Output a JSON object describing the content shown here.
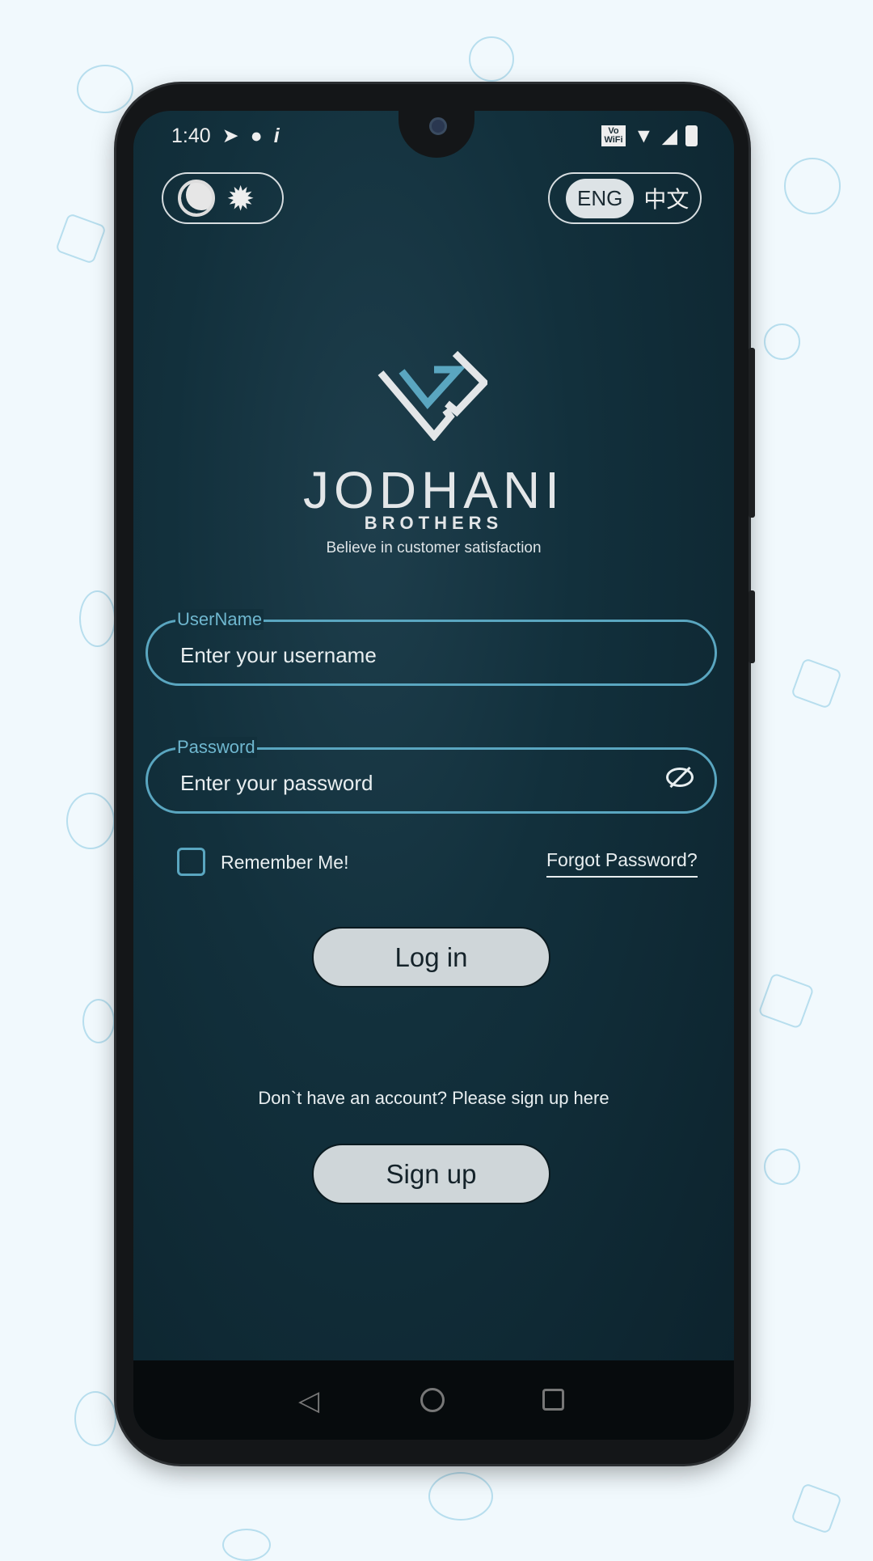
{
  "status_bar": {
    "time": "1:40",
    "right_icons": [
      "vowifi-icon",
      "wifi-icon",
      "signal-icon",
      "battery-icon"
    ],
    "left_icons": [
      "telegram-icon",
      "chat-icon",
      "info-icon"
    ],
    "vowifi": "Vo WiFi"
  },
  "theme_toggle": {
    "icons": [
      "dark-mode-icon",
      "light-mode-icon"
    ]
  },
  "language_toggle": {
    "options": [
      "ENG",
      "中文"
    ],
    "selected": "ENG"
  },
  "brand": {
    "name": "JODHANI",
    "sub": "BROTHERS",
    "tagline": "Believe in customer satisfaction"
  },
  "form": {
    "username": {
      "label": "UserName",
      "placeholder": "Enter your username"
    },
    "password": {
      "label": "Password",
      "placeholder": "Enter your password"
    },
    "remember": "Remember Me!",
    "remember_checked": false,
    "forgot": "Forgot Password?",
    "login": "Log in",
    "signup_prompt": "Don`t have an account? Please sign up here",
    "signup": "Sign up"
  },
  "colors": {
    "accent": "#5aa6c0",
    "button": "#cfd6d9",
    "background": "#12303c"
  }
}
